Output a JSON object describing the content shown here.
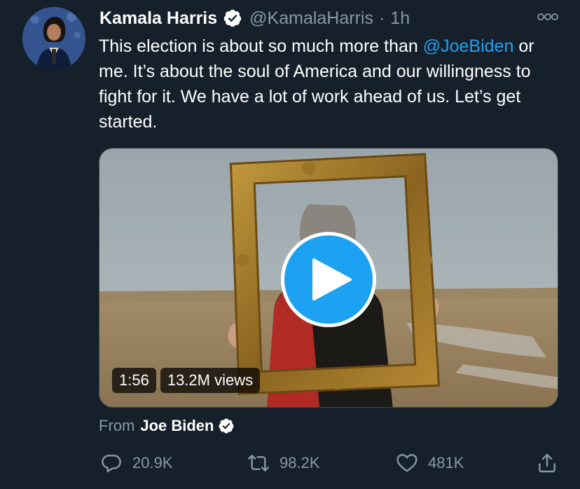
{
  "author": {
    "name": "Kamala Harris",
    "handle": "@KamalaHarris",
    "separator": "·",
    "time": "1h"
  },
  "tweet": {
    "mention": "@JoeBiden",
    "text_before": "This election is about so much more than ",
    "text_after": " or me. It’s about the soul of America and our willingness to fight for it. We have a lot of work ahead of us. Let’s get started."
  },
  "video": {
    "duration": "1:56",
    "views": "13.2M views"
  },
  "source": {
    "prefix": "From",
    "author": "Joe Biden"
  },
  "actions": {
    "replies": "20.9K",
    "retweets": "98.2K",
    "likes": "481K"
  },
  "icons": {
    "verified": "verified-badge-icon",
    "more": "more-options-icon",
    "reply": "reply-icon",
    "retweet": "retweet-icon",
    "like": "heart-icon",
    "share": "share-icon",
    "play": "play-icon"
  },
  "colors": {
    "background": "#15202b",
    "link": "#1da1f2",
    "secondary_text": "#8899a6",
    "play_button": "#1da1f2"
  }
}
